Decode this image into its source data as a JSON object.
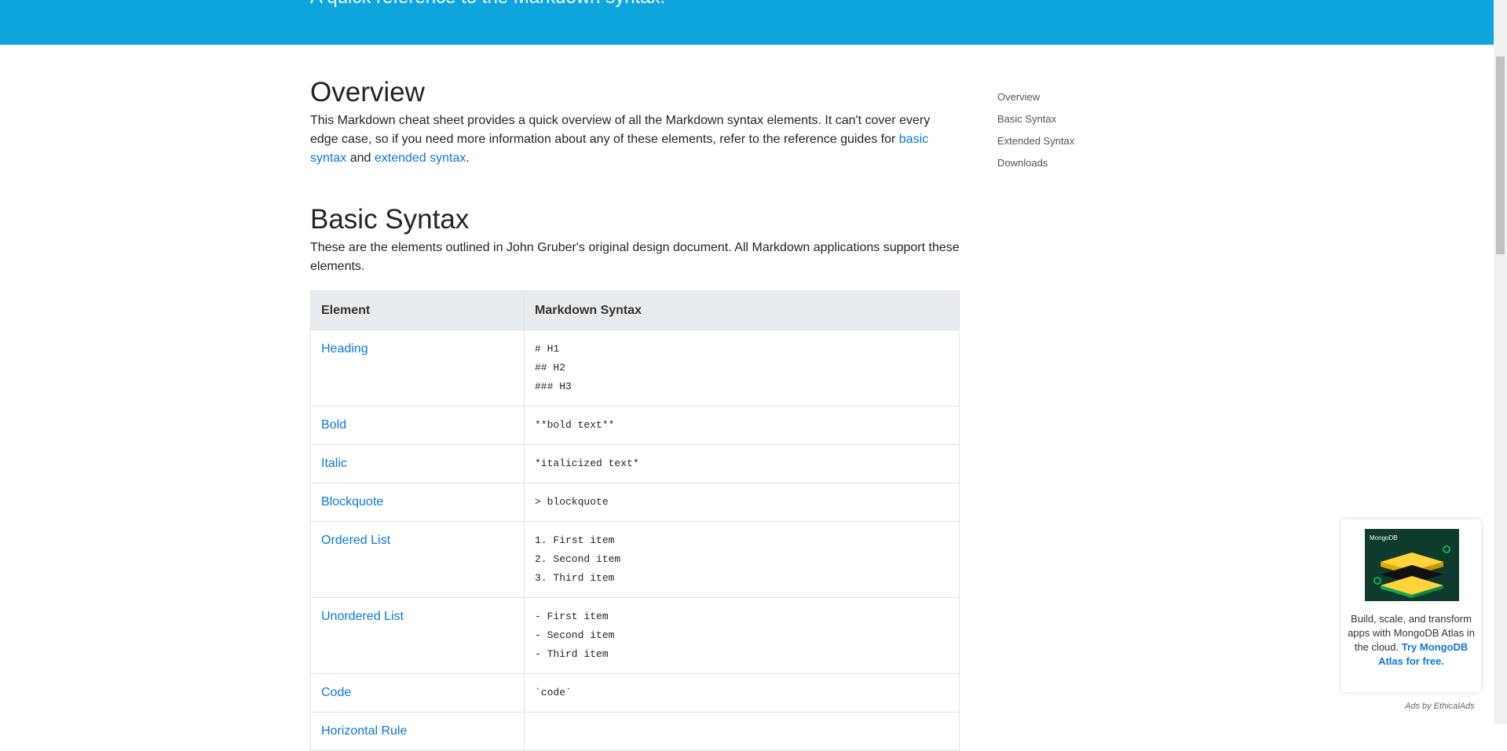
{
  "hero": {
    "subtitle": "A quick reference to the Markdown syntax."
  },
  "overview": {
    "title": "Overview",
    "text_before": "This Markdown cheat sheet provides a quick overview of all the Markdown syntax elements. It can't cover every edge case, so if you need more information about any of these elements, refer to the reference guides for ",
    "link_basic": "basic syntax",
    "text_and": " and ",
    "link_extended": "extended syntax",
    "text_end": "."
  },
  "basic": {
    "title": "Basic Syntax",
    "text": "These are the elements outlined in John Gruber's original design document. All Markdown applications support these elements."
  },
  "table": {
    "headers": [
      "Element",
      "Markdown Syntax"
    ],
    "rows": [
      {
        "element": "Heading",
        "syntax": [
          "# H1",
          "## H2",
          "### H3"
        ]
      },
      {
        "element": "Bold",
        "syntax": [
          "**bold text**"
        ]
      },
      {
        "element": "Italic",
        "syntax": [
          "*italicized text*"
        ]
      },
      {
        "element": "Blockquote",
        "syntax": [
          "> blockquote"
        ]
      },
      {
        "element": "Ordered List",
        "syntax": [
          "1. First item",
          "2. Second item",
          "3. Third item"
        ]
      },
      {
        "element": "Unordered List",
        "syntax": [
          "- First item",
          "- Second item",
          "- Third item"
        ]
      },
      {
        "element": "Code",
        "syntax": [
          "`code`"
        ]
      },
      {
        "element": "Horizontal Rule",
        "syntax": [
          ""
        ]
      }
    ]
  },
  "toc": [
    "Overview",
    "Basic Syntax",
    "Extended Syntax",
    "Downloads"
  ],
  "ad": {
    "brand": "MongoDB",
    "text": "Build, scale, and transform apps with MongoDB Atlas in the cloud. ",
    "cta": "Try MongoDB Atlas for free.",
    "by": "Ads by EthicalAds"
  },
  "colors": {
    "hero": "#0ea5dd",
    "link": "#0d77d9",
    "table_header": "#e9ecef"
  }
}
